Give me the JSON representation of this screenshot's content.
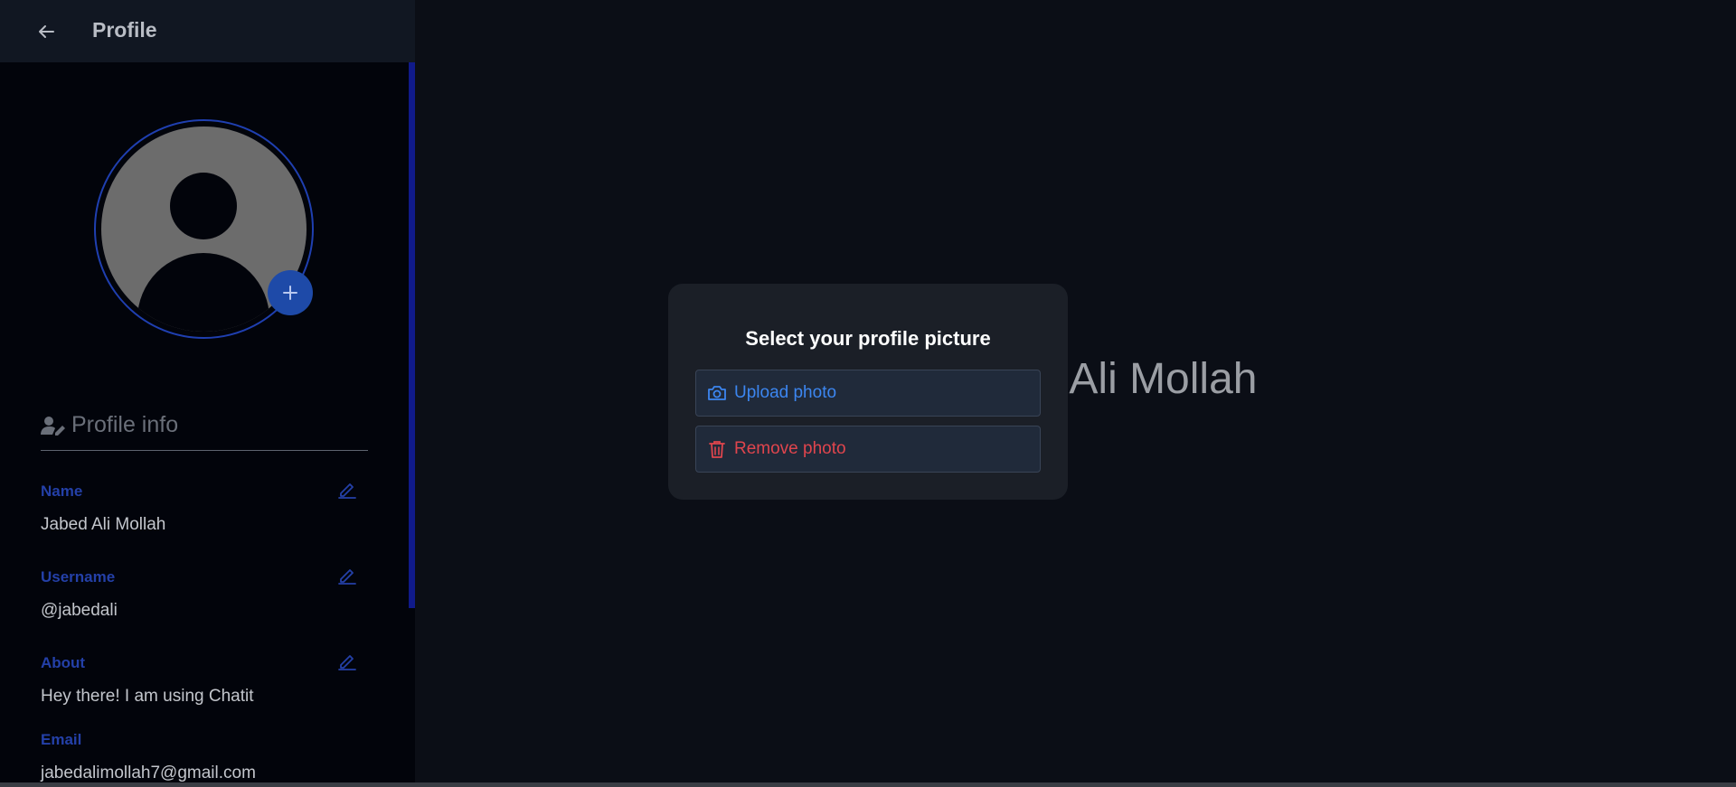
{
  "header": {
    "title": "Profile",
    "back_icon": "arrow-left-icon"
  },
  "avatar": {
    "icon": "default-user-avatar",
    "add_icon": "plus-icon"
  },
  "profile_info": {
    "title": "Profile info",
    "title_icon": "user-edit-icon",
    "fields": [
      {
        "label": "Name",
        "value": "Jabed Ali Mollah",
        "editable": true
      },
      {
        "label": "Username",
        "value": "@jabedali",
        "editable": true
      },
      {
        "label": "About",
        "value": "Hey there! I am using Chatit",
        "editable": true
      },
      {
        "label": "Email",
        "value": "jabedalimollah7@gmail.com",
        "editable": false
      }
    ]
  },
  "main": {
    "background_name": "d Ali Mollah"
  },
  "modal": {
    "title": "Select your profile picture",
    "upload_label": "Upload photo",
    "upload_icon": "camera-icon",
    "remove_label": "Remove photo",
    "remove_icon": "trash-icon"
  },
  "colors": {
    "accent_blue": "#3c86f0",
    "label_blue": "#2440a8",
    "danger_red": "#e0454d",
    "sidebar_bg": "#02040b",
    "main_bg": "#0b0e16"
  }
}
